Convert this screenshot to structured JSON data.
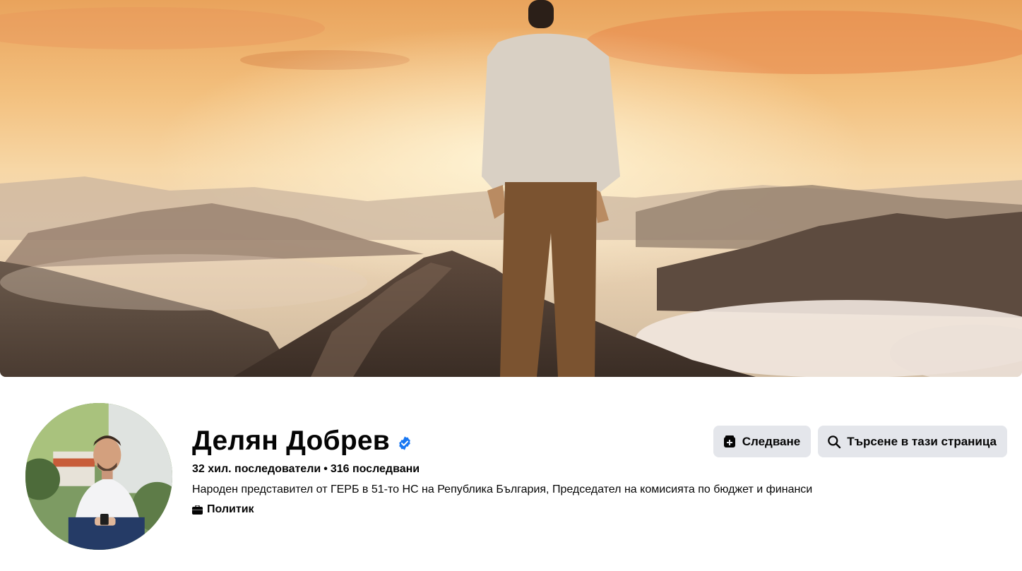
{
  "profile": {
    "name": "Делян Добрев",
    "verified_icon": "verified-badge-icon",
    "followers": "32 хил. последователи",
    "separator": "•",
    "following": "316 последвани",
    "bio": "Народен представител от ГЕРБ в 51-то НС на Република България, Председател на комисията по бюджет и финанси",
    "category": "Политик",
    "category_icon": "briefcase-icon"
  },
  "actions": {
    "follow_label": "Следване",
    "follow_icon": "follow-page-icon",
    "search_label": "Търсене в тази страница",
    "search_icon": "search-icon"
  },
  "colors": {
    "button_bg": "#e4e6eb",
    "verified": "#1877f2",
    "text": "#050505"
  }
}
